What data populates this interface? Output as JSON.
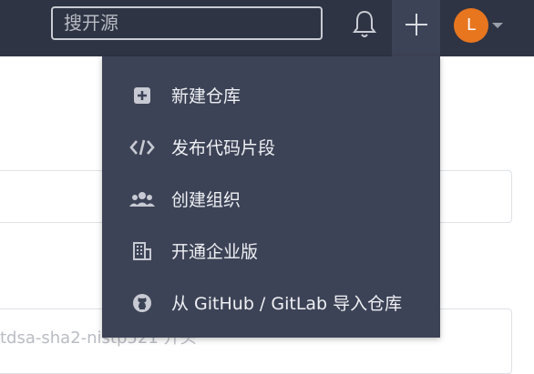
{
  "navbar": {
    "search_placeholder": "搜开源",
    "avatar_initial": "L",
    "accent_color": "#e8761f"
  },
  "background": {
    "partial_text": "tdsa-sha2-nistp521 开头"
  },
  "dropdown": {
    "items": [
      {
        "label": "新建仓库",
        "icon": "new-repo-icon"
      },
      {
        "label": "发布代码片段",
        "icon": "code-icon"
      },
      {
        "label": "创建组织",
        "icon": "group-icon"
      },
      {
        "label": "开通企业版",
        "icon": "building-icon"
      },
      {
        "label": "从 GitHub / GitLab 导入仓库",
        "icon": "github-icon"
      }
    ]
  }
}
